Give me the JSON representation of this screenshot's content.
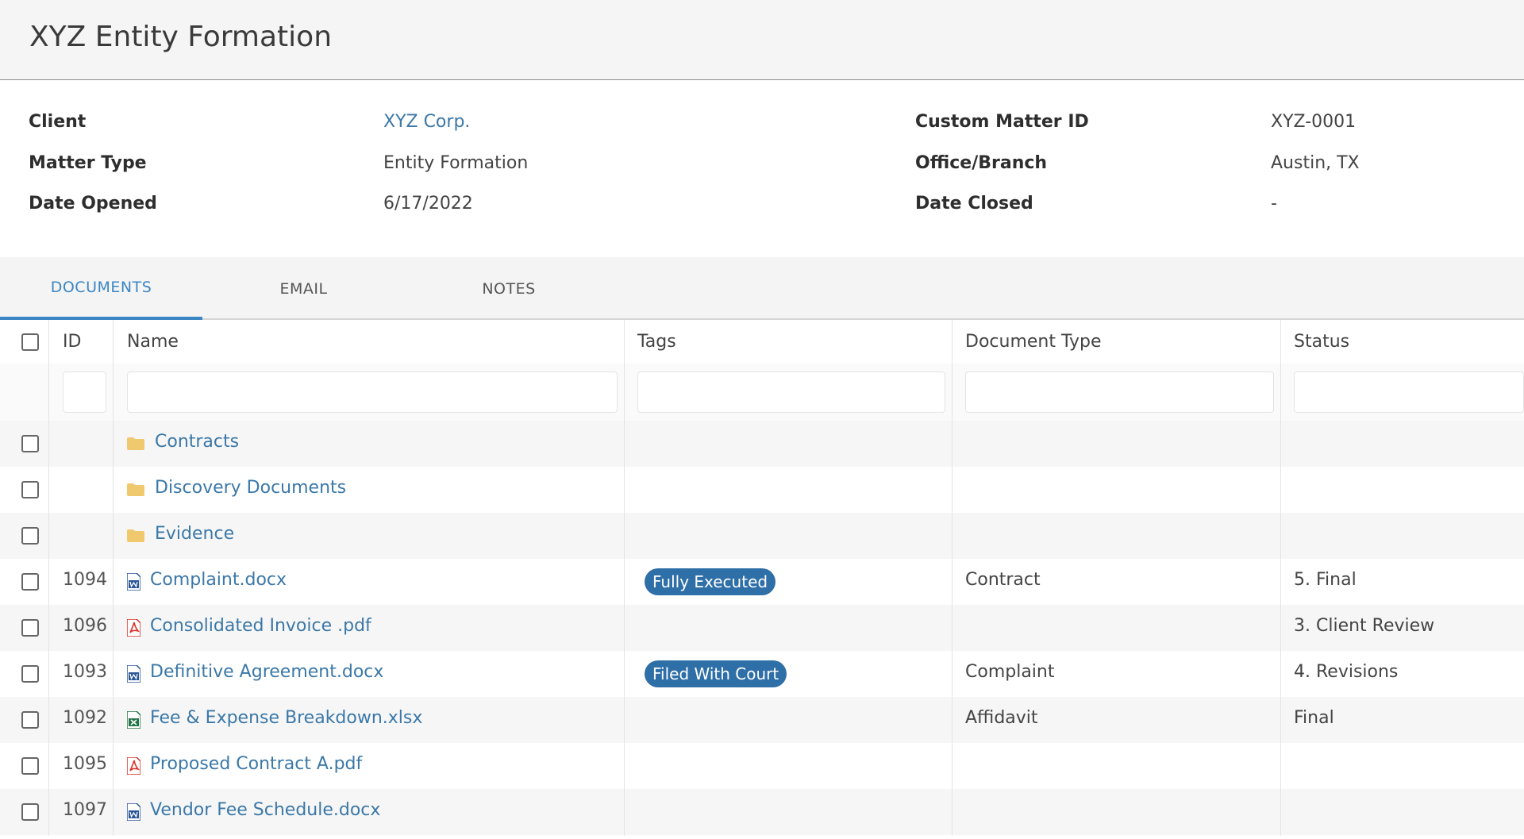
{
  "page": {
    "title": "XYZ Entity Formation"
  },
  "info": {
    "client_label": "Client",
    "client_value": "XYZ Corp.",
    "matter_type_label": "Matter Type",
    "matter_type_value": "Entity Formation",
    "date_opened_label": "Date Opened",
    "date_opened_value": "6/17/2022",
    "custom_id_label": "Custom Matter ID",
    "custom_id_value": "XYZ-0001",
    "office_label": "Office/Branch",
    "office_value": "Austin, TX",
    "date_closed_label": "Date Closed",
    "date_closed_value": "-"
  },
  "tabs": [
    {
      "label": "DOCUMENTS",
      "active": true
    },
    {
      "label": "EMAIL",
      "active": false
    },
    {
      "label": "NOTES",
      "active": false
    }
  ],
  "columns": {
    "id": "ID",
    "name": "Name",
    "tags": "Tags",
    "document_type": "Document Type",
    "status": "Status"
  },
  "rows": [
    {
      "kind": "folder",
      "id": "",
      "name": "Contracts",
      "tag": "",
      "doc_type": "",
      "status": "",
      "icon": "folder-icon"
    },
    {
      "kind": "folder",
      "id": "",
      "name": "Discovery Documents",
      "tag": "",
      "doc_type": "",
      "status": "",
      "icon": "folder-icon"
    },
    {
      "kind": "folder",
      "id": "",
      "name": "Evidence",
      "tag": "",
      "doc_type": "",
      "status": "",
      "icon": "folder-icon"
    },
    {
      "kind": "file",
      "id": "1094",
      "name": "Complaint.docx",
      "tag": "Fully Executed",
      "doc_type": "Contract",
      "status": "5. Final",
      "icon": "word-file-icon"
    },
    {
      "kind": "file",
      "id": "1096",
      "name": "Consolidated Invoice .pdf",
      "tag": "",
      "doc_type": "",
      "status": "3. Client Review",
      "icon": "pdf-file-icon"
    },
    {
      "kind": "file",
      "id": "1093",
      "name": "Definitive Agreement.docx",
      "tag": "Filed With Court",
      "doc_type": "Complaint",
      "status": "4. Revisions",
      "icon": "word-file-icon"
    },
    {
      "kind": "file",
      "id": "1092",
      "name": "Fee & Expense Breakdown.xlsx",
      "tag": "",
      "doc_type": "Affidavit",
      "status": "Final",
      "icon": "excel-file-icon"
    },
    {
      "kind": "file",
      "id": "1095",
      "name": "Proposed Contract A.pdf",
      "tag": "",
      "doc_type": "",
      "status": "",
      "icon": "pdf-file-icon"
    },
    {
      "kind": "file",
      "id": "1097",
      "name": "Vendor Fee Schedule.docx",
      "tag": "",
      "doc_type": "",
      "status": "",
      "icon": "word-file-icon"
    }
  ],
  "colors": {
    "accent": "#3b86c4",
    "link": "#3b78a8",
    "tag_bg": "#2f6fa8",
    "folder": "#f0c96e",
    "word": "#2b579a",
    "pdf": "#d9322a",
    "excel": "#217346"
  }
}
